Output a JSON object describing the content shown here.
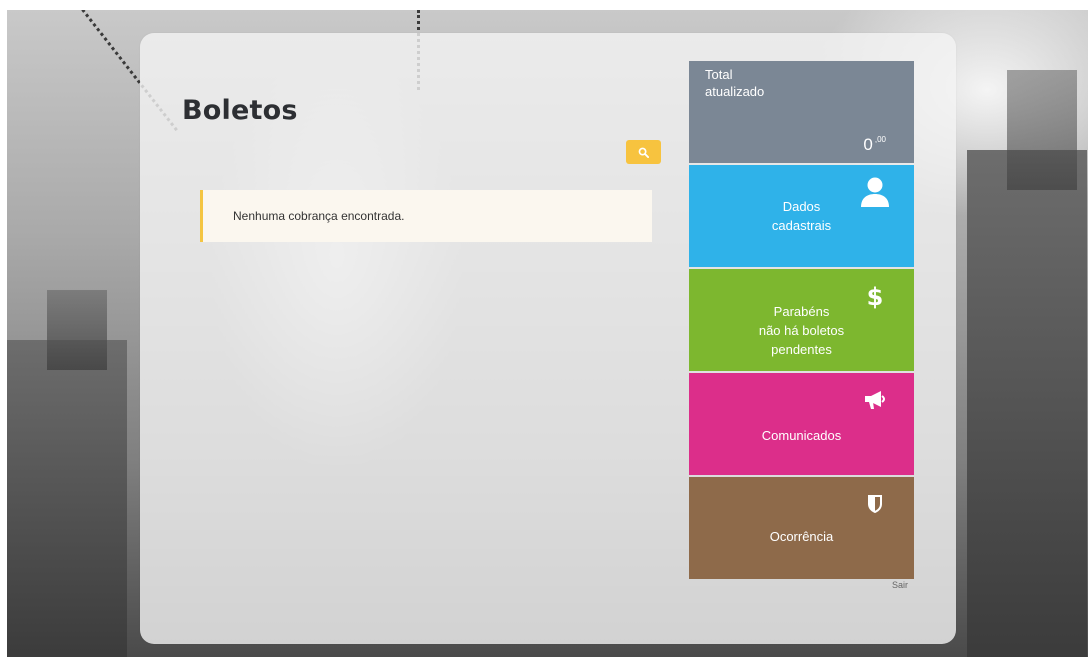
{
  "page": {
    "title": "Boletos"
  },
  "alert": {
    "message": "Nenhuma cobrança encontrada."
  },
  "tiles": [
    {
      "label": "Total\natualizado",
      "value": "0",
      "value_cents": ",00",
      "color": "#7b8795"
    },
    {
      "label": "Dados\ncadastrais",
      "icon": "user-icon",
      "color": "#2fb2e9"
    },
    {
      "label": "Parabéns\nnão há boletos\npendentes",
      "icon": "dollar-icon",
      "color": "#7db72f"
    },
    {
      "label": "Comunicados",
      "icon": "megaphone-icon",
      "color": "#dc2e8a"
    },
    {
      "label": "Ocorrência",
      "icon": "shield-icon",
      "color": "#8e6a4a"
    }
  ],
  "logout": {
    "label": "Sair"
  },
  "icons": {
    "search": "search-icon"
  },
  "colors": {
    "accent_yellow": "#f7c33f",
    "alert_border": "#f4c542"
  }
}
